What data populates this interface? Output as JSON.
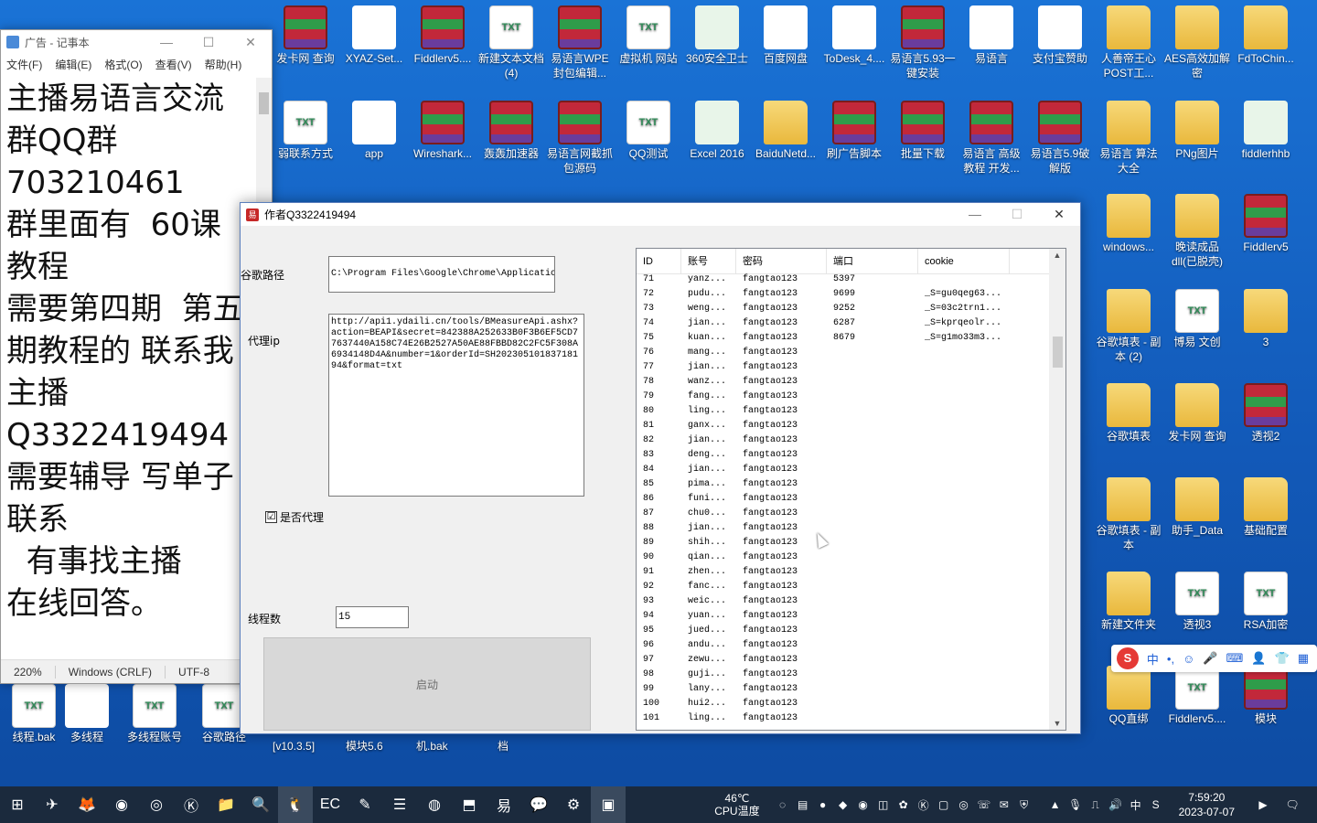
{
  "desktop_icons": [
    {
      "label": "发卡网 查询",
      "type": "rar"
    },
    {
      "label": "XYAZ-Set...",
      "type": "app"
    },
    {
      "label": "Fiddlerv5....",
      "type": "rar"
    },
    {
      "label": "新建文本文档 (4)",
      "type": "txt"
    },
    {
      "label": "易语言WPE封包编辑...",
      "type": "rar"
    },
    {
      "label": "虚拟机 网站",
      "type": "txt"
    },
    {
      "label": "360安全卫士",
      "type": "exe"
    },
    {
      "label": "百度网盘",
      "type": "app"
    },
    {
      "label": "ToDesk_4....",
      "type": "app"
    },
    {
      "label": "易语言5.93一键安装",
      "type": "rar"
    },
    {
      "label": "易语言",
      "type": "app"
    },
    {
      "label": "支付宝赞助",
      "type": "app"
    },
    {
      "label": "人善帝王心POST工...",
      "type": "folder"
    },
    {
      "label": "AES高效加解密",
      "type": "folder"
    },
    {
      "label": "FdToChin...",
      "type": "folder"
    },
    {
      "label": "弱联系方式",
      "type": "txt"
    },
    {
      "label": "app",
      "type": "app"
    },
    {
      "label": "Wireshark...",
      "type": "rar"
    },
    {
      "label": "轰轰加速器",
      "type": "rar"
    },
    {
      "label": "易语言网截抓包源码",
      "type": "rar"
    },
    {
      "label": "QQ测试",
      "type": "txt"
    },
    {
      "label": "Excel 2016",
      "type": "exe"
    },
    {
      "label": "BaiduNetd...",
      "type": "folder"
    },
    {
      "label": "刷广告脚本",
      "type": "rar"
    },
    {
      "label": "批量下载",
      "type": "rar"
    },
    {
      "label": "易语言 高级教程 开发...",
      "type": "rar"
    },
    {
      "label": "易语言5.9破解版",
      "type": "rar"
    },
    {
      "label": "易语言 算法大全",
      "type": "folder"
    },
    {
      "label": "PNg图片",
      "type": "folder"
    },
    {
      "label": "fiddlerhhb",
      "type": "exe"
    },
    {
      "label": "windows...",
      "type": "folder"
    },
    {
      "label": "晚读成品dll(已脱壳)",
      "type": "folder"
    },
    {
      "label": "Fiddlerv5",
      "type": "rar"
    },
    {
      "label": "谷歌填表 - 副本 (2)",
      "type": "folder"
    },
    {
      "label": "博易 文创",
      "type": "txt"
    },
    {
      "label": "3",
      "type": "folder"
    },
    {
      "label": "谷歌填表",
      "type": "folder"
    },
    {
      "label": "发卡网 查询",
      "type": "folder"
    },
    {
      "label": "透视2",
      "type": "rar"
    },
    {
      "label": "谷歌填表 - 副本",
      "type": "folder"
    },
    {
      "label": "助手_Data",
      "type": "folder"
    },
    {
      "label": "基础配置",
      "type": "folder"
    },
    {
      "label": "新建文件夹",
      "type": "folder"
    },
    {
      "label": "透视3",
      "type": "txt"
    },
    {
      "label": "RSA加密",
      "type": "txt"
    },
    {
      "label": "QQ直绑",
      "type": "folder"
    },
    {
      "label": "Fiddlerv5....",
      "type": "txt"
    },
    {
      "label": "模块",
      "type": "rar"
    }
  ],
  "bottom_icons": [
    {
      "label": "线程.bak",
      "type": "txt"
    },
    {
      "label": "多线程",
      "type": "app"
    },
    {
      "label": "多线程账号",
      "type": "txt"
    },
    {
      "label": "谷歌路径",
      "type": "txt"
    }
  ],
  "below_window_labels": [
    "[v10.3.5]",
    "模块5.6",
    "机.bak",
    "档"
  ],
  "notepad": {
    "title": "广告 - 记事本",
    "menu": [
      "文件(F)",
      "编辑(E)",
      "格式(O)",
      "查看(V)",
      "帮助(H)"
    ],
    "content": "主播易语言交流\n群QQ群\n703210461\n群里面有  60课\n教程\n需要第四期  第五\n期教程的 联系我\n主播\nQ3322419494\n需要辅导 写单子\n联系\n  有事找主播\n在线回答。",
    "status": {
      "zoom": "220%",
      "line_ending": "Windows (CRLF)",
      "encoding": "UTF-8"
    }
  },
  "app_window": {
    "title": "作者Q3322419494",
    "chrome_path_label": "谷歌路径",
    "chrome_path_value": "C:\\Program Files\\Google\\Chrome\\Applicatic",
    "proxy_label": "代理ip",
    "proxy_value": "http://api1.ydaili.cn/tools/BMeasureApi.ashx?action=BEAPI&secret=842388A252633B0F3B6EF5CD77637440A158C74E26B2527A50AE88FBBD82C2FC5F308A6934148D4A&number=1&orderId=SH20230510183718194&format=txt",
    "use_proxy_label": "是否代理",
    "use_proxy_checked": "☑",
    "threads_label": "线程数",
    "threads_value": "15",
    "start_button": "启动",
    "columns": [
      "ID",
      "账号",
      "密码",
      "端口",
      "cookie"
    ],
    "rows": [
      [
        "71",
        "yanz...",
        "fangtao123",
        "5397",
        ""
      ],
      [
        "72",
        "pudu...",
        "fangtao123",
        "9699",
        "_S=gu0qeg63..."
      ],
      [
        "73",
        "weng...",
        "fangtao123",
        "9252",
        "_S=03c2trn1..."
      ],
      [
        "74",
        "jian...",
        "fangtao123",
        "6287",
        "_S=kprqeolr..."
      ],
      [
        "75",
        "kuan...",
        "fangtao123",
        "8679",
        "_S=g1mo33m3..."
      ],
      [
        "76",
        "mang...",
        "fangtao123",
        "",
        ""
      ],
      [
        "77",
        "jian...",
        "fangtao123",
        "",
        ""
      ],
      [
        "78",
        "wanz...",
        "fangtao123",
        "",
        ""
      ],
      [
        "79",
        "fang...",
        "fangtao123",
        "",
        ""
      ],
      [
        "80",
        "ling...",
        "fangtao123",
        "",
        ""
      ],
      [
        "81",
        "ganx...",
        "fangtao123",
        "",
        ""
      ],
      [
        "82",
        "jian...",
        "fangtao123",
        "",
        ""
      ],
      [
        "83",
        "deng...",
        "fangtao123",
        "",
        ""
      ],
      [
        "84",
        "jian...",
        "fangtao123",
        "",
        ""
      ],
      [
        "85",
        "pima...",
        "fangtao123",
        "",
        ""
      ],
      [
        "86",
        "funi...",
        "fangtao123",
        "",
        ""
      ],
      [
        "87",
        "chu0...",
        "fangtao123",
        "",
        ""
      ],
      [
        "88",
        "jian...",
        "fangtao123",
        "",
        ""
      ],
      [
        "89",
        "shih...",
        "fangtao123",
        "",
        ""
      ],
      [
        "90",
        "qian...",
        "fangtao123",
        "",
        ""
      ],
      [
        "91",
        "zhen...",
        "fangtao123",
        "",
        ""
      ],
      [
        "92",
        "fanc...",
        "fangtao123",
        "",
        ""
      ],
      [
        "93",
        "weic...",
        "fangtao123",
        "",
        ""
      ],
      [
        "94",
        "yuan...",
        "fangtao123",
        "",
        ""
      ],
      [
        "95",
        "jued...",
        "fangtao123",
        "",
        ""
      ],
      [
        "96",
        "andu...",
        "fangtao123",
        "",
        ""
      ],
      [
        "97",
        "zewu...",
        "fangtao123",
        "",
        ""
      ],
      [
        "98",
        "guji...",
        "fangtao123",
        "",
        ""
      ],
      [
        "99",
        "lany...",
        "fangtao123",
        "",
        ""
      ],
      [
        "100",
        "hui2...",
        "fangtao123",
        "",
        ""
      ],
      [
        "101",
        "ling...",
        "fangtao123",
        "",
        ""
      ]
    ]
  },
  "ime_bar": {
    "logo": "S",
    "mode": "中",
    "punct": "•,",
    "emoji": "☺",
    "mic": "🎤",
    "keyboard": "⌨",
    "user": "👤",
    "shirt": "👕",
    "grid": "▦"
  },
  "taskbar": {
    "temp": "46℃",
    "temp_label": "CPU温度",
    "ime_mode": "中",
    "time": "7:59:20",
    "date": "2023-07-07"
  }
}
